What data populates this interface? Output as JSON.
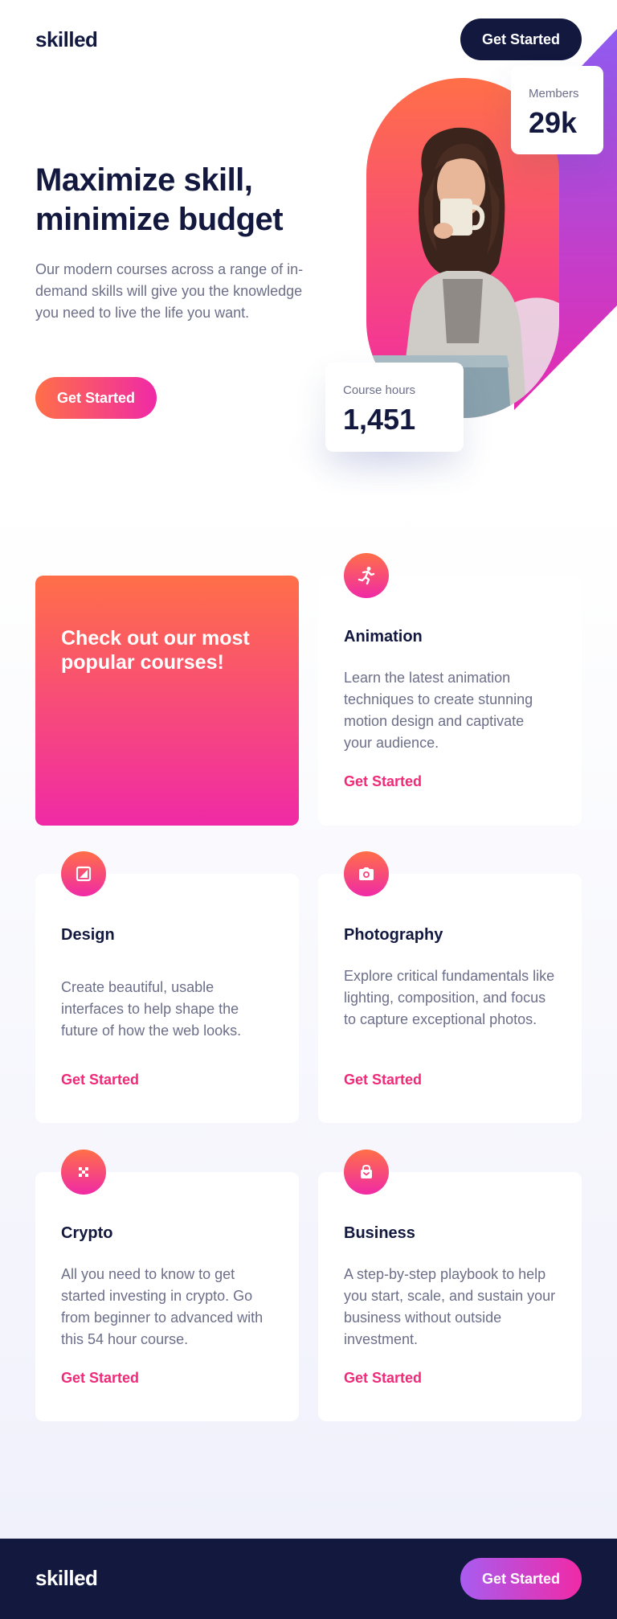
{
  "header": {
    "logo": "skilled",
    "cta_label": "Get Started"
  },
  "hero": {
    "title": "Maximize skill, minimize budget",
    "description": "Our modern courses across a range of in-demand skills will give you the knowledge you need to live the life you want.",
    "cta_label": "Get Started",
    "members": {
      "label": "Members",
      "value": "29k"
    },
    "course_hours": {
      "label": "Course hours",
      "value": "1,451"
    }
  },
  "courses": {
    "promo_text": "Check out our most popular courses!",
    "items": [
      {
        "title": "Animation",
        "description": "Learn the latest animation techniques to create stunning motion design and captivate your audience.",
        "link": "Get Started",
        "icon": "running-figure-icon"
      },
      {
        "title": "Design",
        "description": "Create beautiful, usable interfaces to help shape the future of how the web looks.",
        "link": "Get Started",
        "icon": "design-icon"
      },
      {
        "title": "Photography",
        "description": "Explore critical fundamentals like lighting, composition, and focus to capture exceptional photos.",
        "link": "Get Started",
        "icon": "camera-icon"
      },
      {
        "title": "Crypto",
        "description": "All you need to know to get started investing in crypto. Go from beginner to advanced with this 54 hour course.",
        "link": "Get Started",
        "icon": "crypto-icon"
      },
      {
        "title": "Business",
        "description": "A step-by-step playbook to help you start, scale, and sustain your business without outside investment.",
        "link": "Get Started",
        "icon": "shopping-bag-icon"
      }
    ]
  },
  "footer": {
    "logo": "skilled",
    "cta_label": "Get Started"
  },
  "colors": {
    "navy": "#13183f",
    "gradient_start": "#ff6f48",
    "gradient_end": "#f02aa6",
    "link_pink": "#f02a78",
    "text_muted": "#6c6f89",
    "purple": "#a85cf0"
  }
}
